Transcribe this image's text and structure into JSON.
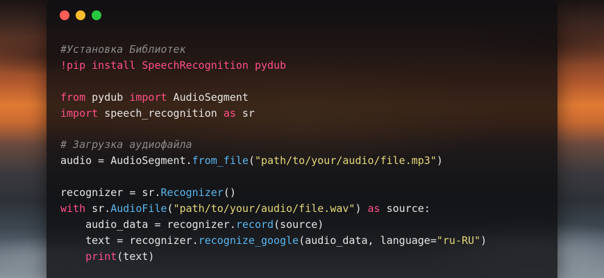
{
  "window": {
    "controls": [
      {
        "name": "close",
        "color": "#ff5f57"
      },
      {
        "name": "minimize",
        "color": "#febc2e"
      },
      {
        "name": "maximize",
        "color": "#28c840"
      }
    ]
  },
  "code": {
    "lines": [
      [
        {
          "t": "cm",
          "v": "#Установка Библиотек"
        }
      ],
      [
        {
          "t": "kw",
          "v": "!pip install SpeechRecognition pydub"
        }
      ],
      [],
      [
        {
          "t": "kw",
          "v": "from"
        },
        {
          "t": "tx",
          "v": " pydub "
        },
        {
          "t": "kw",
          "v": "import"
        },
        {
          "t": "tx",
          "v": " AudioSegment"
        }
      ],
      [
        {
          "t": "kw",
          "v": "import"
        },
        {
          "t": "tx",
          "v": " speech_recognition "
        },
        {
          "t": "kw",
          "v": "as"
        },
        {
          "t": "tx",
          "v": " sr"
        }
      ],
      [],
      [
        {
          "t": "cm",
          "v": "# Загрузка аудиофайла"
        }
      ],
      [
        {
          "t": "tx",
          "v": "audio = AudioSegment."
        },
        {
          "t": "fn",
          "v": "from_file"
        },
        {
          "t": "tx",
          "v": "("
        },
        {
          "t": "st",
          "v": "\"path/to/your/audio/file.mp3\""
        },
        {
          "t": "tx",
          "v": ")"
        }
      ],
      [],
      [
        {
          "t": "tx",
          "v": "recognizer = sr."
        },
        {
          "t": "fn",
          "v": "Recognizer"
        },
        {
          "t": "tx",
          "v": "()"
        }
      ],
      [
        {
          "t": "kw",
          "v": "with"
        },
        {
          "t": "tx",
          "v": " sr."
        },
        {
          "t": "fn",
          "v": "AudioFile"
        },
        {
          "t": "tx",
          "v": "("
        },
        {
          "t": "st",
          "v": "\"path/to/your/audio/file.wav\""
        },
        {
          "t": "tx",
          "v": ") "
        },
        {
          "t": "kw",
          "v": "as"
        },
        {
          "t": "tx",
          "v": " source:"
        }
      ],
      [
        {
          "t": "tx",
          "v": "    audio_data = recognizer."
        },
        {
          "t": "fn",
          "v": "record"
        },
        {
          "t": "tx",
          "v": "(source)"
        }
      ],
      [
        {
          "t": "tx",
          "v": "    text = recognizer."
        },
        {
          "t": "fn",
          "v": "recognize_google"
        },
        {
          "t": "tx",
          "v": "(audio_data, language="
        },
        {
          "t": "st",
          "v": "\"ru-RU\""
        },
        {
          "t": "tx",
          "v": ")"
        }
      ],
      [
        {
          "t": "tx",
          "v": "    "
        },
        {
          "t": "kw",
          "v": "print"
        },
        {
          "t": "tx",
          "v": "(text)"
        }
      ]
    ]
  }
}
